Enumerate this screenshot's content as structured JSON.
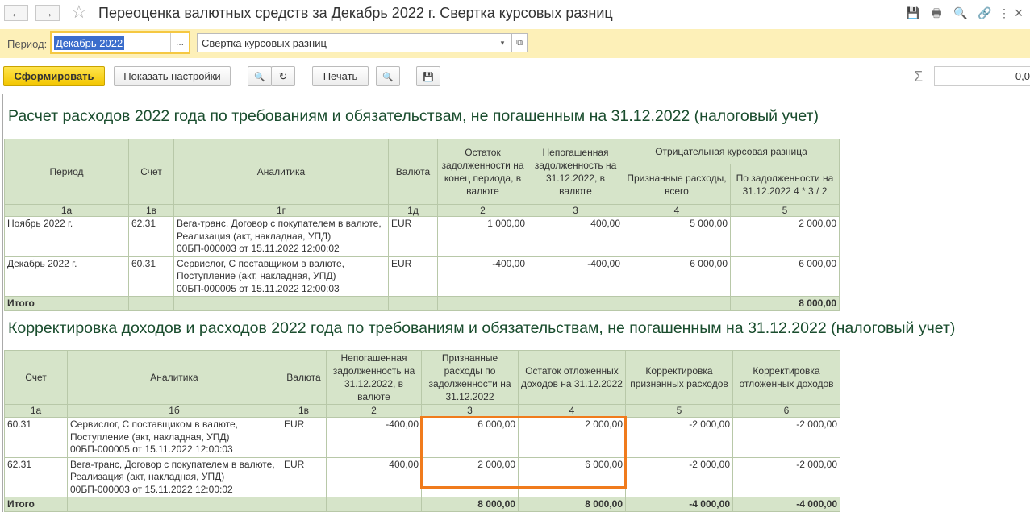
{
  "window": {
    "title": "Переоценка валютных средств за Декабрь 2022 г. Свертка курсовых разниц",
    "back_icon": "←",
    "forward_icon": "→",
    "star_icon": "☆",
    "save_icon": "💾",
    "print_icon": "🖶",
    "preview_icon": "🔍",
    "link_icon": "🔗",
    "more_icon": "⋮",
    "close_icon": "×"
  },
  "filter": {
    "period_label": "Период:",
    "period_value": "Декабрь 2022",
    "period_button": "...",
    "variant_value": "Свертка курсовых разниц",
    "variant_drop_icon": "▾",
    "variant_open_icon": "⧉"
  },
  "toolbar": {
    "generate_label": "Сформировать",
    "settings_label": "Показать настройки",
    "search_icon": "🔍",
    "search_next_icon": "↻",
    "print_label": "Печать",
    "preview_icon": "🔍",
    "save_icon": "💾",
    "sum_icon": "Σ",
    "sum_value": "0,0"
  },
  "report1": {
    "heading": "Расчет расходов 2022 года по требованиям и обязательствам, не погашенным на 31.12.2022 (налоговый учет)",
    "headers": {
      "period": "Период",
      "account": "Счет",
      "analytics": "Аналитика",
      "currency": "Валюта",
      "balance": "Остаток задолженности на конец периода, в валюте",
      "unpaid": "Непогашенная задолженность на 31.12.2022, в валюте",
      "negative": "Отрицательная курсовая разница",
      "recognized": "Признанные расходы, всего",
      "by_debt": "По задолженности на 31.12.2022 4 * 3 / 2"
    },
    "numbers": [
      "1а",
      "1в",
      "1г",
      "1д",
      "2",
      "3",
      "4",
      "5"
    ],
    "rows": [
      {
        "period": "Ноябрь 2022 г.",
        "account": "62.31",
        "analytics1": "Вега-транс, Договор с покупателем в валюте,",
        "analytics2": "Реализация (акт, накладная, УПД)",
        "analytics3": "00БП-000003 от 15.11.2022 12:00:02",
        "currency": "EUR",
        "balance": "1 000,00",
        "unpaid": "400,00",
        "recognized": "5 000,00",
        "by_debt": "2 000,00"
      },
      {
        "period": "Декабрь 2022 г.",
        "account": "60.31",
        "analytics1": "Сервислог, С поставщиком в валюте,",
        "analytics2": "Поступление (акт, накладная, УПД)",
        "analytics3": "00БП-000005 от 15.11.2022 12:00:03",
        "currency": "EUR",
        "balance": "-400,00",
        "unpaid": "-400,00",
        "recognized": "6 000,00",
        "by_debt": "6 000,00"
      }
    ],
    "total_label": "Итого",
    "total_by_debt": "8 000,00"
  },
  "report2": {
    "heading": "Корректировка доходов и расходов 2022 года по требованиям и обязательствам, не погашенным на 31.12.2022 (налоговый учет)",
    "headers": {
      "account": "Счет",
      "analytics": "Аналитика",
      "currency": "Валюта",
      "unpaid": "Непогашенная задолженность на 31.12.2022, в валюте",
      "recognized": "Признанные расходы по задолженности на 31.12.2022",
      "deferred": "Остаток отложенных доходов на 31.12.2022",
      "adj_recognized": "Корректировка признанных расходов",
      "adj_deferred": "Корректировка отложенных доходов"
    },
    "numbers": [
      "1а",
      "1б",
      "1в",
      "2",
      "3",
      "4",
      "5",
      "6"
    ],
    "rows": [
      {
        "account": "60.31",
        "analytics1": "Сервислог, С поставщиком в валюте,",
        "analytics2": "Поступление (акт, накладная, УПД)",
        "analytics3": "00БП-000005 от 15.11.2022 12:00:03",
        "currency": "EUR",
        "unpaid": "-400,00",
        "recognized": "6 000,00",
        "deferred": "2 000,00",
        "adj_recognized": "-2 000,00",
        "adj_deferred": "-2 000,00"
      },
      {
        "account": "62.31",
        "analytics1": "Вега-транс, Договор с покупателем в валюте,",
        "analytics2": "Реализация (акт, накладная, УПД)",
        "analytics3": "00БП-000003 от 15.11.2022 12:00:02",
        "currency": "EUR",
        "unpaid": "400,00",
        "recognized": "2 000,00",
        "deferred": "6 000,00",
        "adj_recognized": "-2 000,00",
        "adj_deferred": "-2 000,00"
      }
    ],
    "total_label": "Итого",
    "total_recognized": "8 000,00",
    "total_deferred": "8 000,00",
    "total_adj_recognized": "-4 000,00",
    "total_adj_deferred": "-4 000,00"
  },
  "colors": {
    "header_bg": "#d6e4c9",
    "accent_yellow": "#f3c600",
    "highlight": "#f07b1c"
  }
}
